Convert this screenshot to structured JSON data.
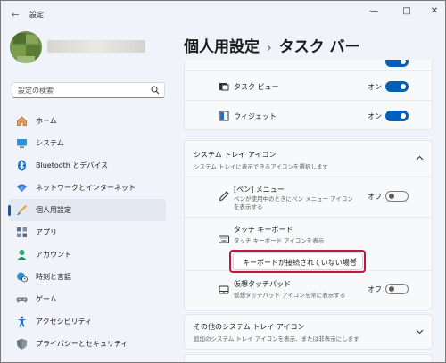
{
  "window": {
    "title": "設定",
    "back_icon": "back-arrow-icon",
    "controls": [
      "minimize",
      "maximize",
      "close"
    ]
  },
  "search": {
    "placeholder": "設定の検索",
    "icon": "search-icon"
  },
  "sidebar": {
    "items": [
      {
        "label": "ホーム",
        "icon": "home-icon",
        "active": false
      },
      {
        "label": "システム",
        "icon": "system-icon",
        "active": false
      },
      {
        "label": "Bluetooth とデバイス",
        "icon": "bluetooth-icon",
        "active": false
      },
      {
        "label": "ネットワークとインターネット",
        "icon": "wifi-icon",
        "active": false
      },
      {
        "label": "個人用設定",
        "icon": "brush-icon",
        "active": true
      },
      {
        "label": "アプリ",
        "icon": "apps-icon",
        "active": false
      },
      {
        "label": "アカウント",
        "icon": "account-icon",
        "active": false
      },
      {
        "label": "時刻と言語",
        "icon": "globe-clock-icon",
        "active": false
      },
      {
        "label": "ゲーム",
        "icon": "gamepad-icon",
        "active": false
      },
      {
        "label": "アクセシビリティ",
        "icon": "accessibility-icon",
        "active": false
      },
      {
        "label": "プライバシーとセキュリティ",
        "icon": "shield-icon",
        "active": false
      }
    ]
  },
  "header": {
    "breadcrumb_parent": "個人用設定",
    "separator": "›",
    "breadcrumb_current": "タスク バー"
  },
  "taskbar_items": {
    "rows": [
      {
        "label": "タスク ビュー",
        "state": "オン",
        "on": true,
        "icon": "task-view-icon"
      },
      {
        "label": "ウィジェット",
        "state": "オン",
        "on": true,
        "icon": "widgets-icon"
      }
    ]
  },
  "system_tray": {
    "title": "システム トレイ アイコン",
    "subtitle": "システム トレイに表示できるアイコンを選択します",
    "expanded": true,
    "rows": [
      {
        "label": "[ペン] メニュー",
        "sub": "ペンが使用中のときにペン メニュー アイコンを表示する",
        "state": "オフ",
        "on": false,
        "icon": "pen-icon"
      },
      {
        "label": "タッチ キーボード",
        "sub": "タッチ キーボード アイコンを表示",
        "icon": "keyboard-icon"
      },
      {
        "label": "仮想タッチパッド",
        "sub": "仮想タッチパッド アイコンを常に表示する",
        "state": "オフ",
        "on": false,
        "icon": "touchpad-icon"
      }
    ],
    "keyboard_dropdown": {
      "value": "キーボードが接続されていない場合"
    }
  },
  "other_tray": {
    "title": "その他のシステム トレイ アイコン",
    "subtitle": "追加のシステム トレイ アイコンを表示、または非表示にします"
  },
  "colors": {
    "accent": "#005fb8",
    "highlight": "#c0163f"
  }
}
